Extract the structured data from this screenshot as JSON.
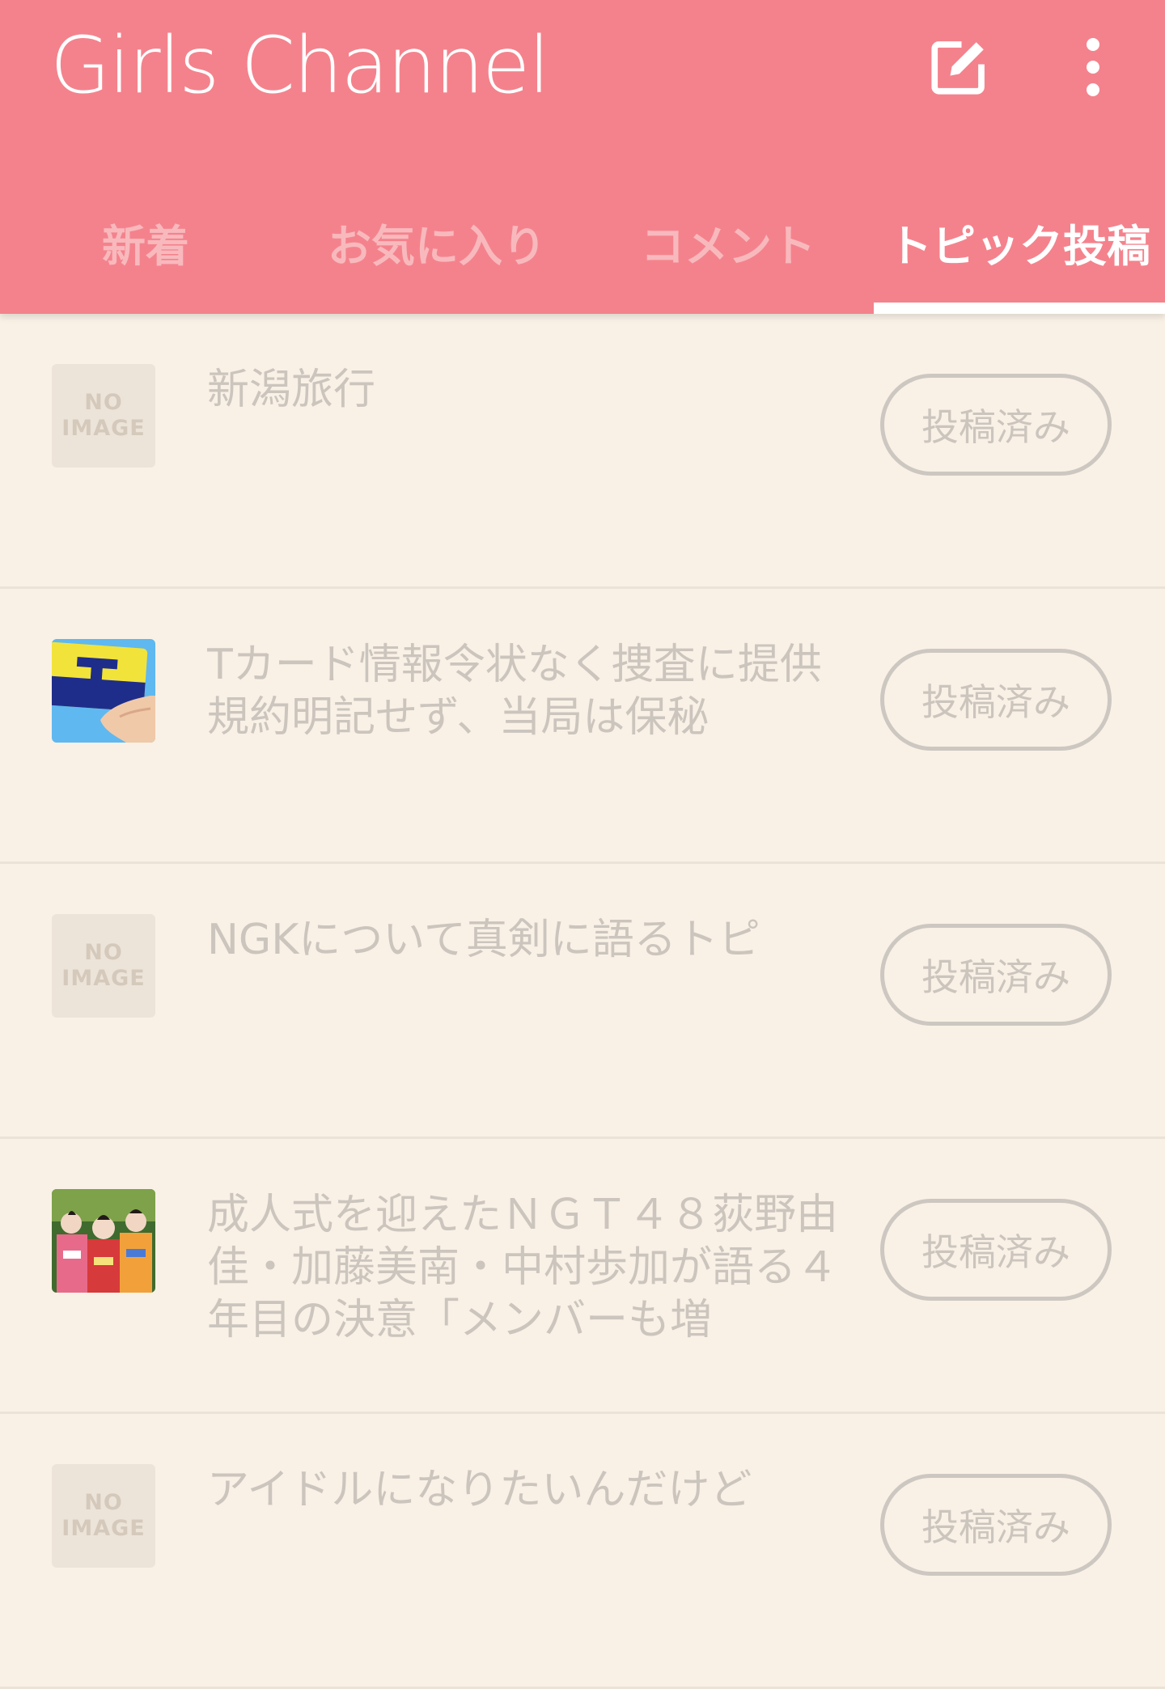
{
  "app": {
    "title": "Girls Channel",
    "brand_color": "#f4828c",
    "background_color": "#f9f1e6",
    "actions": [
      {
        "icon": "edit-icon"
      },
      {
        "icon": "more-vertical-icon"
      }
    ]
  },
  "tabs": [
    {
      "label": "新着",
      "active": false
    },
    {
      "label": "お気に入り",
      "active": false
    },
    {
      "label": "コメント",
      "active": false
    },
    {
      "label": "トピック投稿",
      "active": true
    }
  ],
  "topics": [
    {
      "title": "新潟旅行",
      "thumbnail": "no-image",
      "thumbnail_text": [
        "NO",
        "IMAGE"
      ],
      "status_label": "投稿済み"
    },
    {
      "title": "Tカード情報令状なく捜査に提供 規約明記せず、当局は保秘",
      "thumbnail": "t-card-photo",
      "status_label": "投稿済み"
    },
    {
      "title": "NGKについて真剣に語るトピ",
      "thumbnail": "no-image",
      "thumbnail_text": [
        "NO",
        "IMAGE"
      ],
      "status_label": "投稿済み"
    },
    {
      "title": "成人式を迎えたＮＧＴ４８荻野由佳・加藤美南・中村歩加が語る４年目の決意「メンバーも増",
      "thumbnail": "group-photo",
      "status_label": "投稿済み"
    },
    {
      "title": "アイドルになりたいんだけど",
      "thumbnail": "no-image",
      "thumbnail_text": [
        "NO",
        "IMAGE"
      ],
      "status_label": "投稿済み"
    }
  ]
}
